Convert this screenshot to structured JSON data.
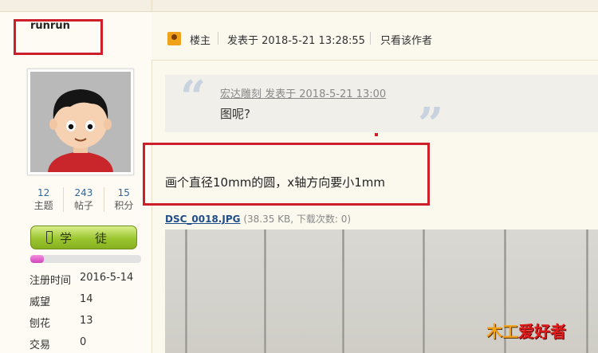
{
  "user": {
    "username": "runrun",
    "stats": [
      {
        "value": "12",
        "label": "主题"
      },
      {
        "value": "243",
        "label": "帖子"
      },
      {
        "value": "15",
        "label": "积分"
      }
    ],
    "rank": {
      "left": "学",
      "right": "徒"
    },
    "progress_percent": 12,
    "register_label": "注册时间",
    "register_date": "2016-5-14",
    "fields": [
      {
        "label": "威望",
        "value": "14"
      },
      {
        "label": "刨花",
        "value": "13"
      },
      {
        "label": "交易",
        "value": "0"
      }
    ]
  },
  "post": {
    "owner_label": "楼主",
    "posted_at": "发表于 2018-5-21 13:28:55",
    "only_author_label": "只看该作者",
    "quote": {
      "author_line": "宏达雕刻 发表于 2018-5-21 13:00",
      "text": "图呢?"
    },
    "message": "画个直径10mm的圆，x轴方向要小1mm",
    "attachment": {
      "filename": "DSC_0018.JPG",
      "info": "(38.35 KB, 下载次数: 0)"
    }
  },
  "watermark": {
    "part1": "木工",
    "part2": "爱好者"
  },
  "colors": {
    "highlight": "#cc1f2a",
    "accent_green": "#9bc630",
    "link_blue": "#1f4d8a"
  }
}
